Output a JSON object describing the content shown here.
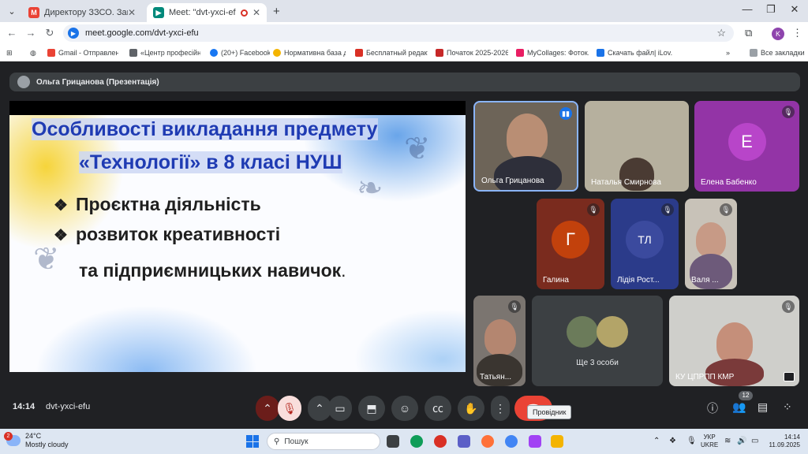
{
  "browser": {
    "tabs": [
      {
        "title": "Директору ЗЗСО. Запрошення",
        "favicon": "gmail-icon",
        "active": false
      },
      {
        "title": "Meet: \"dvt-yxci-efu\"",
        "favicon": "meet-icon",
        "active": true
      }
    ],
    "url": "meet.google.com/dvt-yxci-efu",
    "profile_initial": "K",
    "bookmarks": [
      {
        "label": "Gmail - Отправлен...",
        "color": "#ea4335"
      },
      {
        "label": "«Центр професійн...",
        "color": "#5f6368"
      },
      {
        "label": "(20+) Facebook",
        "color": "#1877f2"
      },
      {
        "label": "Нормативна база д...",
        "color": "#f4b400"
      },
      {
        "label": "Бесплатный редакт...",
        "color": "#d93025"
      },
      {
        "label": "Початок 2025-2026...",
        "color": "#c62828"
      },
      {
        "label": "MyCollages: Фоток...",
        "color": "#e91e63"
      },
      {
        "label": "Скачать файл| iLov...",
        "color": "#1a73e8"
      }
    ],
    "all_bookmarks": "Все закладки"
  },
  "meet": {
    "presenter_label": "Ольга Грицанова (Презентація)",
    "slide": {
      "title_line1": "Особливості викладання предмету",
      "title_line2": "«Технології» в 8 класі НУШ",
      "bullet1": "Проєктна діяльність",
      "bullet2": "розвиток креативності",
      "line3": "та підприємницьких навичок",
      "line3_end": "."
    },
    "participants": {
      "p1": "Ольга Грицанова",
      "p2": "Наталья Смирнова",
      "p3": "Елена Бабенко",
      "p3_initial": "E",
      "p4": "Галина",
      "p4_initial": "Г",
      "p5": "Лідія Рост...",
      "p6": "Валя ...",
      "p7": "Татьян...",
      "more": "Ще 3 особи",
      "p8": "КУ ЦПРПП КМР"
    },
    "time": "14:14",
    "code": "dvt-yxci-efu",
    "people_count": "12",
    "tooltip": "Провідник"
  },
  "taskbar": {
    "temp": "24°C",
    "weather": "Mostly cloudy",
    "weather_badge": "2",
    "search": "Пошук",
    "lang1": "УКР",
    "lang2": "UKRE",
    "time": "14:14",
    "date": "11.09.2025"
  }
}
